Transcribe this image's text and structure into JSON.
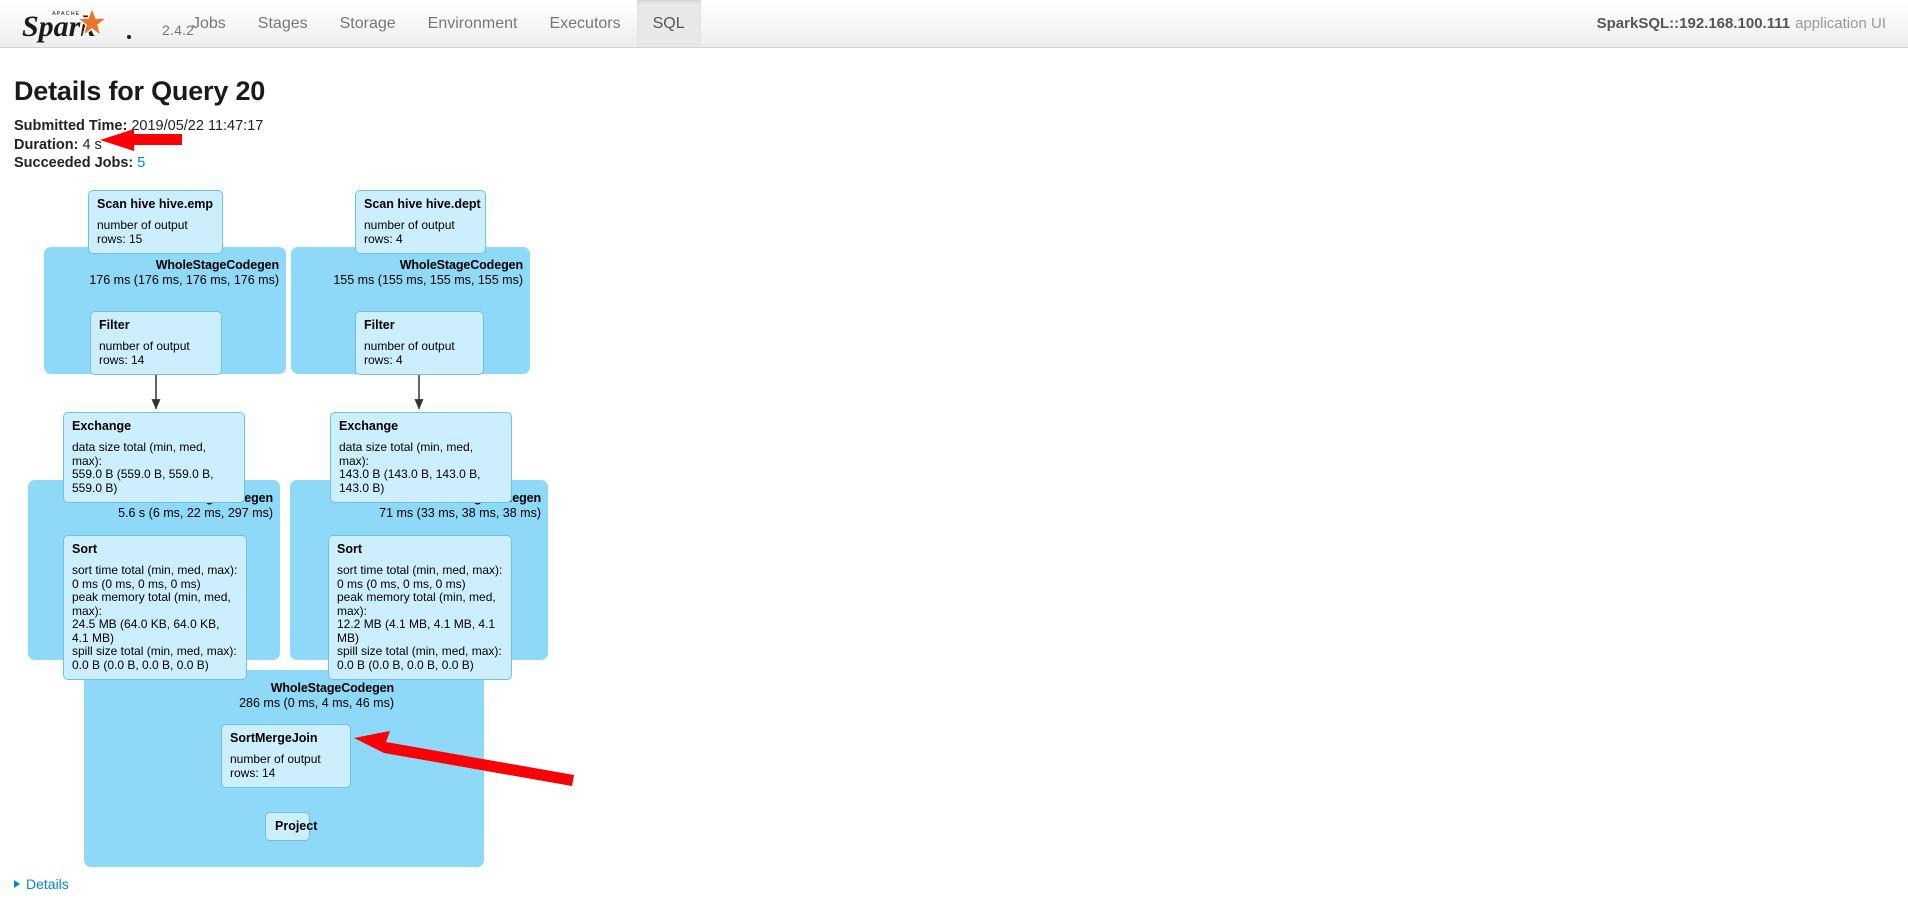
{
  "navbar": {
    "brand_name": "Spark",
    "brand_mark": "APACHE",
    "version": "2.4.2",
    "items": [
      {
        "label": "Jobs",
        "active": false
      },
      {
        "label": "Stages",
        "active": false
      },
      {
        "label": "Storage",
        "active": false
      },
      {
        "label": "Environment",
        "active": false
      },
      {
        "label": "Executors",
        "active": false
      },
      {
        "label": "SQL",
        "active": true
      }
    ],
    "app_name_bold": "SparkSQL::192.168.100.111",
    "app_name_rest": "application UI"
  },
  "header": {
    "title": "Details for Query 20",
    "submitted_time_label": "Submitted Time:",
    "submitted_time_value": "2019/05/22 11:47:17",
    "duration_label": "Duration:",
    "duration_value": "4 s",
    "succeeded_jobs_label": "Succeeded Jobs:",
    "succeeded_jobs_value": "5"
  },
  "dag": {
    "clusters": [
      {
        "id": "codegen-left-1",
        "title": "WholeStageCodegen",
        "metrics": "176 ms (176 ms, 176 ms, 176 ms)"
      },
      {
        "id": "codegen-right-1",
        "title": "WholeStageCodegen",
        "metrics": "155 ms (155 ms, 155 ms, 155 ms)"
      },
      {
        "id": "codegen-left-2",
        "title": "WholeStageCodegen",
        "metrics": "5.6 s (6 ms, 22 ms, 297 ms)"
      },
      {
        "id": "codegen-right-2",
        "title": "WholeStageCodegen",
        "metrics": "71 ms (33 ms, 38 ms, 38 ms)"
      },
      {
        "id": "codegen-join",
        "title": "WholeStageCodegen",
        "metrics": "286 ms (0 ms, 4 ms, 46 ms)"
      }
    ],
    "nodes": [
      {
        "id": "scan-emp",
        "title": "Scan hive hive.emp",
        "metrics": "number of output rows: 15"
      },
      {
        "id": "scan-dept",
        "title": "Scan hive hive.dept",
        "metrics": "number of output rows: 4"
      },
      {
        "id": "filter-left",
        "title": "Filter",
        "metrics": "number of output rows: 14"
      },
      {
        "id": "filter-right",
        "title": "Filter",
        "metrics": "number of output rows: 4"
      },
      {
        "id": "exchange-left",
        "title": "Exchange",
        "metrics": "data size total (min, med, max):\n559.0 B (559.0 B, 559.0 B, 559.0 B)"
      },
      {
        "id": "exchange-right",
        "title": "Exchange",
        "metrics": "data size total (min, med, max):\n143.0 B (143.0 B, 143.0 B, 143.0 B)"
      },
      {
        "id": "sort-left",
        "title": "Sort",
        "metrics": "sort time total (min, med, max):\n0 ms (0 ms, 0 ms, 0 ms)\npeak memory total (min, med, max):\n24.5 MB (64.0 KB, 64.0 KB, 4.1 MB)\nspill size total (min, med, max):\n0.0 B (0.0 B, 0.0 B, 0.0 B)"
      },
      {
        "id": "sort-right",
        "title": "Sort",
        "metrics": "sort time total (min, med, max):\n0 ms (0 ms, 0 ms, 0 ms)\npeak memory total (min, med, max):\n12.2 MB (4.1 MB, 4.1 MB, 4.1 MB)\nspill size total (min, med, max):\n0.0 B (0.0 B, 0.0 B, 0.0 B)"
      },
      {
        "id": "sort-merge-join",
        "title": "SortMergeJoin",
        "metrics": "number of output rows: 14"
      },
      {
        "id": "project",
        "title": "Project",
        "metrics": ""
      }
    ]
  },
  "footer": {
    "details_label": "Details"
  },
  "colors": {
    "cluster_fill": "#8ed8f8",
    "node_fill": "#cdeffd",
    "node_border": "#6ec2ea",
    "link": "#0088cc",
    "annotation_arrow": "#fb0007",
    "active_tab_bg": "#e8e8e8"
  }
}
